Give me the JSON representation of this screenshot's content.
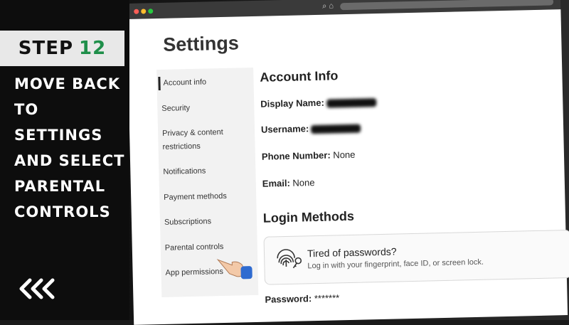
{
  "overlay": {
    "step_label": "STEP",
    "step_number": "12",
    "instruction_lines": [
      "MOVE BACK",
      "TO",
      "SETTINGS",
      "AND SELECT",
      "PARENTAL",
      "CONTROLS"
    ],
    "accent_color": "#1f8f4a",
    "back_icon": "double-chevron-left-icon"
  },
  "page": {
    "title": "Settings",
    "sidebar": [
      {
        "label": "Account info",
        "active": true
      },
      {
        "label": "Security"
      },
      {
        "label": "Privacy & content"
      },
      {
        "label": "restrictions"
      },
      {
        "label": "Notifications"
      },
      {
        "label": "Payment methods"
      },
      {
        "label": "Subscriptions"
      },
      {
        "label": "Parental controls"
      },
      {
        "label": "App permissions"
      }
    ],
    "account_info": {
      "title": "Account Info",
      "display_name_label": "Display Name:",
      "username_label": "Username:",
      "phone_label": "Phone Number:",
      "phone_value": "None",
      "email_label": "Email:",
      "email_value": "None"
    },
    "login_methods": {
      "title": "Login Methods",
      "card_title": "Tired of passwords?",
      "card_subtitle": "Log in with your fingerprint, face ID, or screen lock.",
      "card_icon": "fingerprint-key-icon",
      "password_label": "Password:",
      "password_value": "*******"
    }
  }
}
